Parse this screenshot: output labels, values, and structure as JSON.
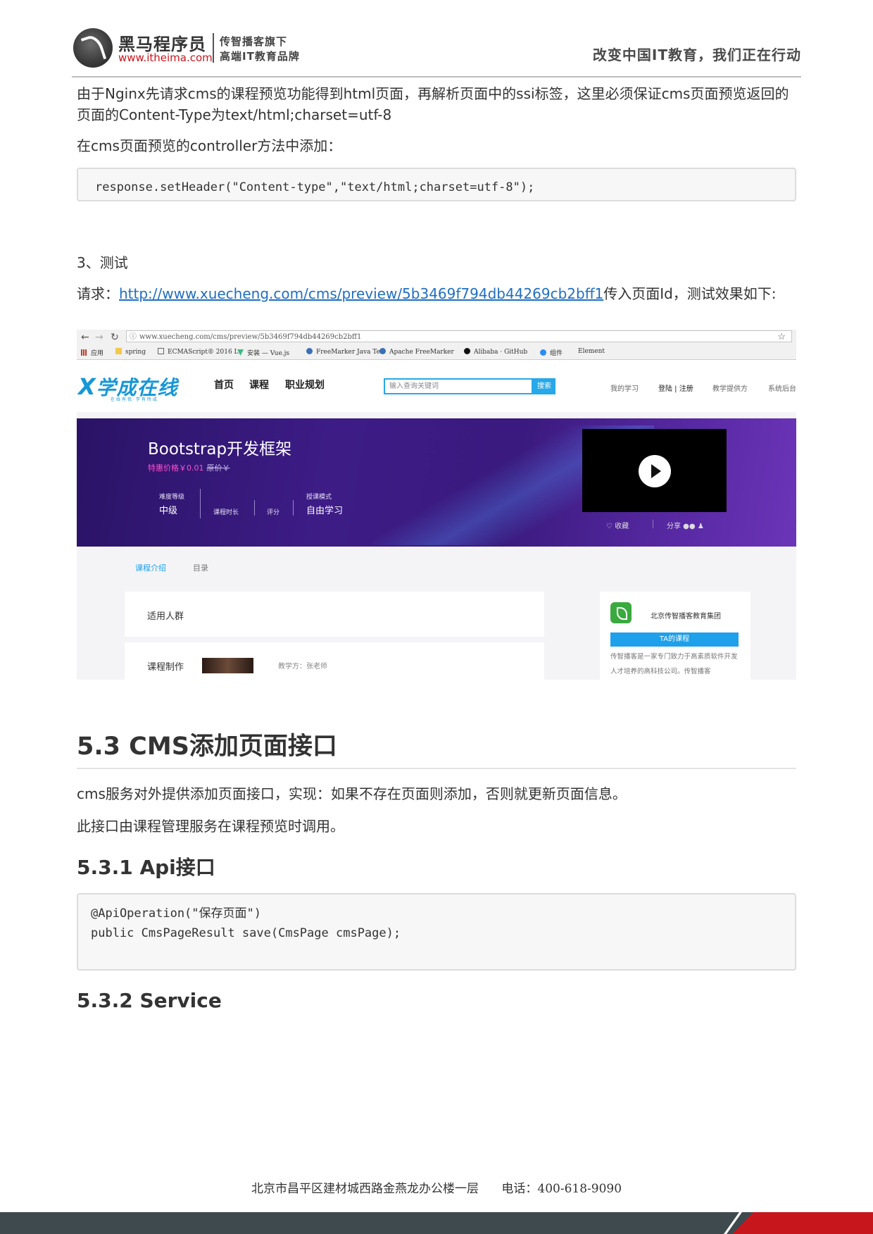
{
  "header": {
    "brand_name": "黑马程序员",
    "brand_url": "www.itheima.com",
    "tagline_line1": "传智播客旗下",
    "tagline_line2": "高端IT教育品牌",
    "slogan": "改变中国IT教育，我们正在行动"
  },
  "body": {
    "para1": "由于Nginx先请求cms的课程预览功能得到html页面，再解析页面中的ssi标签，这里必须保证cms页面预览返回的页面的Content-Type为text/html;charset=utf-8",
    "para2": "在cms页面预览的controller方法中添加：",
    "code1": "response.setHeader(\"Content-type\",\"text/html;charset=utf-8\");",
    "step3": "3、测试",
    "request_prefix": "请求：",
    "request_link": "http://www.xuecheng.com/cms/preview/5b3469f794db44269cb2bff1",
    "request_suffix": "传入页面Id，测试效果如下:",
    "h2": "5.3 CMS添加页面接口",
    "para3": "cms服务对外提供添加页面接口，实现：如果不存在页面则添加，否则就更新页面信息。",
    "para4": "此接口由课程管理服务在课程预览时调用。",
    "h3_api": "5.3.1 Api接口",
    "code2_line1": "@ApiOperation(\"保存页面\")",
    "code2_line2": "public CmsPageResult save(CmsPage cmsPage);",
    "h3_service": "5.3.2 Service"
  },
  "screenshot": {
    "browser": {
      "address": "www.xuecheng.com/cms/preview/5b3469f794db44269cb2bff1",
      "bookmarks": [
        "应用",
        "spring",
        "ECMAScript® 2016 L",
        "安装 — Vue.js",
        "FreeMarker Java Te",
        "Apache FreeMarker",
        "Alibaba · GitHub",
        "组件",
        "Element"
      ]
    },
    "site": {
      "logo": "学成在线",
      "logo_sub": "在线有我·学有所成",
      "nav": [
        "首页",
        "课程",
        "职业规划"
      ],
      "search_placeholder": "输入查询关键词",
      "search_button": "搜索",
      "my_learning": "我的学习",
      "login_register": "登陆 | 注册",
      "teacher_provider": "教学提供方",
      "admin": "系统后台"
    },
    "banner": {
      "title": "Bootstrap开发框架",
      "price": "特惠价格￥0.01",
      "original_price": "原价￥",
      "difficulty_label": "难度等级",
      "difficulty_value": "中级",
      "duration_label": "课程时长",
      "rating_label": "评分",
      "mode_label": "授课模式",
      "mode_value": "自由学习",
      "favorite": "收藏",
      "share": "分享"
    },
    "tabs": [
      "课程介绍",
      "目录"
    ],
    "audience_label": "适用人群",
    "production_label": "课程制作",
    "teacher": "教学方：张老师",
    "org_name": "北京传智播客教育集团",
    "org_button": "TA的课程",
    "org_desc": "传智播客是一家专门致力于高素质软件开发人才培养的高科技公司。传智播客"
  },
  "footer": {
    "address": "北京市昌平区建材城西路金燕龙办公楼一层",
    "phone": "电话：400-618-9090"
  },
  "colors": {
    "link": "#1f6fc2",
    "brand_red": "#c8161d",
    "site_blue": "#1597d8",
    "footer_bar": "#3e4a4e"
  }
}
